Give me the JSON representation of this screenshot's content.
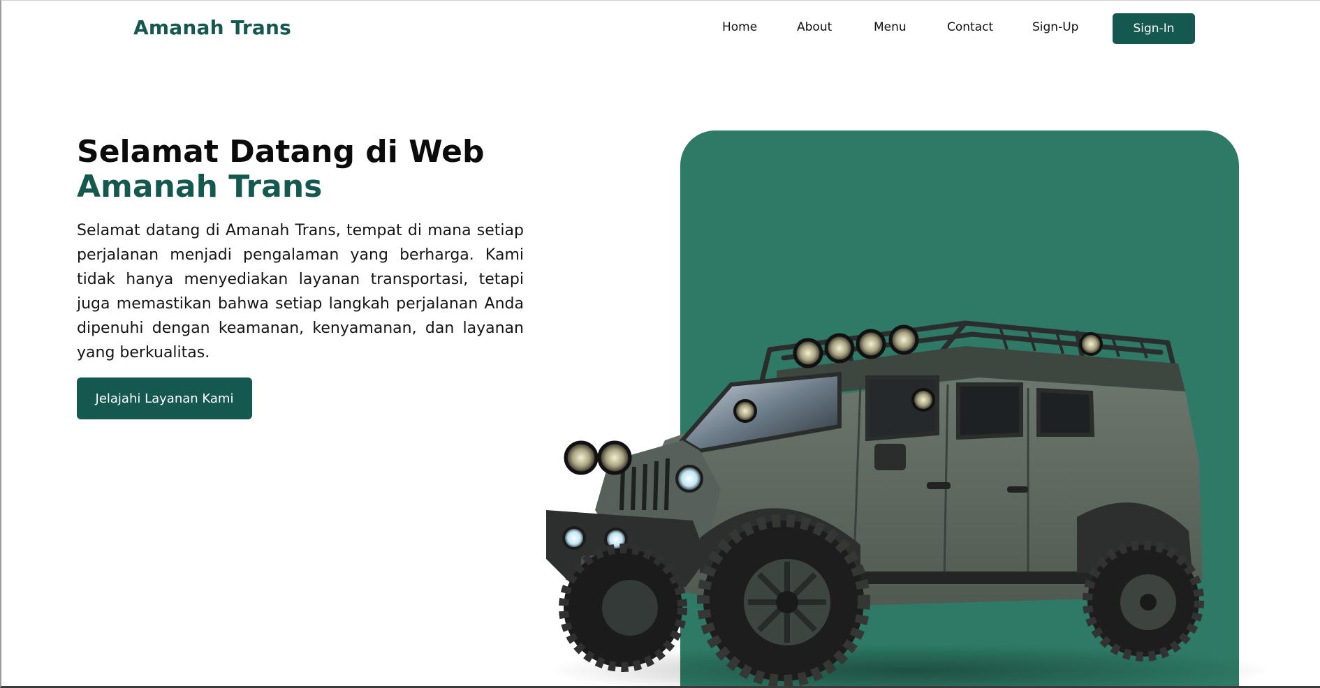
{
  "nav": {
    "brand": "Amanah Trans",
    "links": [
      "Home",
      "About",
      "Menu",
      "Contact",
      "Sign-Up"
    ],
    "signin_label": "Sign-In"
  },
  "hero": {
    "title_line1": "Selamat Datang di Web",
    "title_line2": "Amanah Trans",
    "description": "Selamat datang di Amanah Trans, tempat di mana setiap perjalanan menjadi pengalaman yang berharga. Kami tidak hanya menyediakan layanan transportasi, tetapi juga memastikan bahwa setiap langkah perjalanan Anda dipenuhi dengan keamanan, kenyamanan, dan layanan yang berkualitas.",
    "cta_label": "Jelajahi Layanan Kami",
    "image": "jeep-offroad-vehicle"
  },
  "colors": {
    "brand": "#15584f",
    "panel": "#2e7a66",
    "jeep_body": "#5d6b61"
  }
}
